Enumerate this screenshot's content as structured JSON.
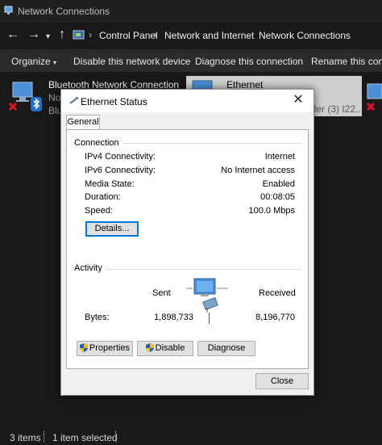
{
  "explorer": {
    "window_title": "Network Connections",
    "breadcrumb": [
      "Control Panel",
      "Network and Internet",
      "Network Connections"
    ],
    "commands": {
      "organize": "Organize",
      "disable": "Disable this network device",
      "diagnose": "Diagnose this connection",
      "rename": "Rename this conne"
    },
    "connections": [
      {
        "name": "Bluetooth Network Connection",
        "line2": "No",
        "line3": "Blu"
      },
      {
        "name": "Ethernet",
        "line3_tail": "ller (3) I22..."
      }
    ],
    "status": {
      "items": "3 items",
      "selected": "1 item selected"
    }
  },
  "dialog": {
    "title": "Ethernet Status",
    "close_glyph": "✕",
    "tab": "General",
    "connection": {
      "label": "Connection",
      "rows": [
        {
          "label": "IPv4 Connectivity:",
          "value": "Internet"
        },
        {
          "label": "IPv6 Connectivity:",
          "value": "No Internet access"
        },
        {
          "label": "Media State:",
          "value": "Enabled"
        },
        {
          "label": "Duration:",
          "value": "00:08:05"
        },
        {
          "label": "Speed:",
          "value": "100.0 Mbps"
        }
      ],
      "details_button": "Details..."
    },
    "activity": {
      "label": "Activity",
      "sent_label": "Sent",
      "received_label": "Received",
      "bytes_label": "Bytes:",
      "bytes_sent": "1,898,733",
      "bytes_received": "8,196,770"
    },
    "buttons": {
      "properties": "Properties",
      "disable": "Disable",
      "diagnose": "Diagnose",
      "close": "Close"
    }
  },
  "colors": {
    "accent": "#0078d7",
    "disconnected": "#e81123"
  }
}
